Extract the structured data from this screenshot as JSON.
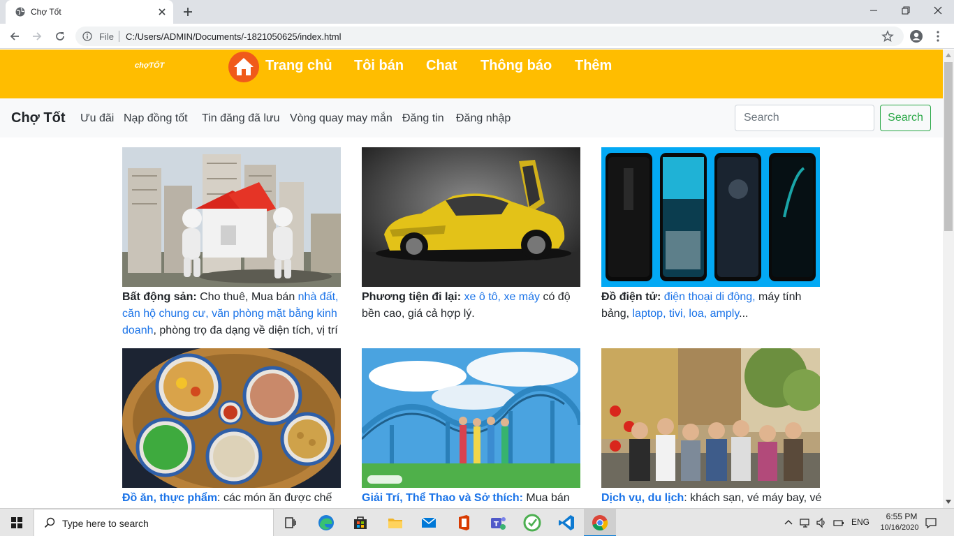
{
  "browser": {
    "tab_title": "Chợ Tốt",
    "omnibox_scheme": "File",
    "url": "C:/Users/ADMIN/Documents/-1821050625/index.html"
  },
  "site": {
    "logo_text": "chợTỐT",
    "top_nav": [
      "Trang chủ",
      "Tôi bán",
      "Chat",
      "Thông báo",
      "Thêm"
    ],
    "brand": "Chợ Tốt",
    "sub_nav": [
      "Ưu đãi",
      "Nạp đồng tốt",
      "Tin đăng đã lưu",
      "Vòng quay may mắn",
      "Đăng tin",
      "Đăng nhập"
    ],
    "search_placeholder": "Search",
    "search_button": "Search",
    "colors": {
      "topbar": "#ffbd00",
      "link": "#1a73e8",
      "search_green": "#28a745"
    }
  },
  "cards": [
    {
      "heading": "Bất động sản:",
      "t1": " Cho thuê, Mua bán ",
      "l1": "nhà đất, căn hộ chung cư, văn phòng mặt bằng kinh doanh",
      "t2": ", phòng trọ đa dạng về diện tích, vị trí"
    },
    {
      "heading": "Phương tiện đi lại:",
      "l1": " xe ô tô, xe máy",
      "t1": " có độ bền cao, giá cả hợp lý."
    },
    {
      "heading": "Đồ điện tử:",
      "l1": " điện thoại di động,",
      "t1": " máy tính bảng, ",
      "l2": "laptop, tivi, loa, amply",
      "t2": "..."
    },
    {
      "heading": "Đồ ăn, thực phẩm",
      "t1": ": các món ăn được chế"
    },
    {
      "heading": "Giải Trí, Thể Thao và Sở thích:",
      "t1": " Mua bán"
    },
    {
      "heading": "Dịch vụ, du lịch",
      "t1": ": khách sạn, vé máy bay, vé"
    }
  ],
  "taskbar": {
    "search_text": "Type here to search",
    "lang": "ENG",
    "time": "6:55 PM",
    "date": "10/16/2020"
  }
}
